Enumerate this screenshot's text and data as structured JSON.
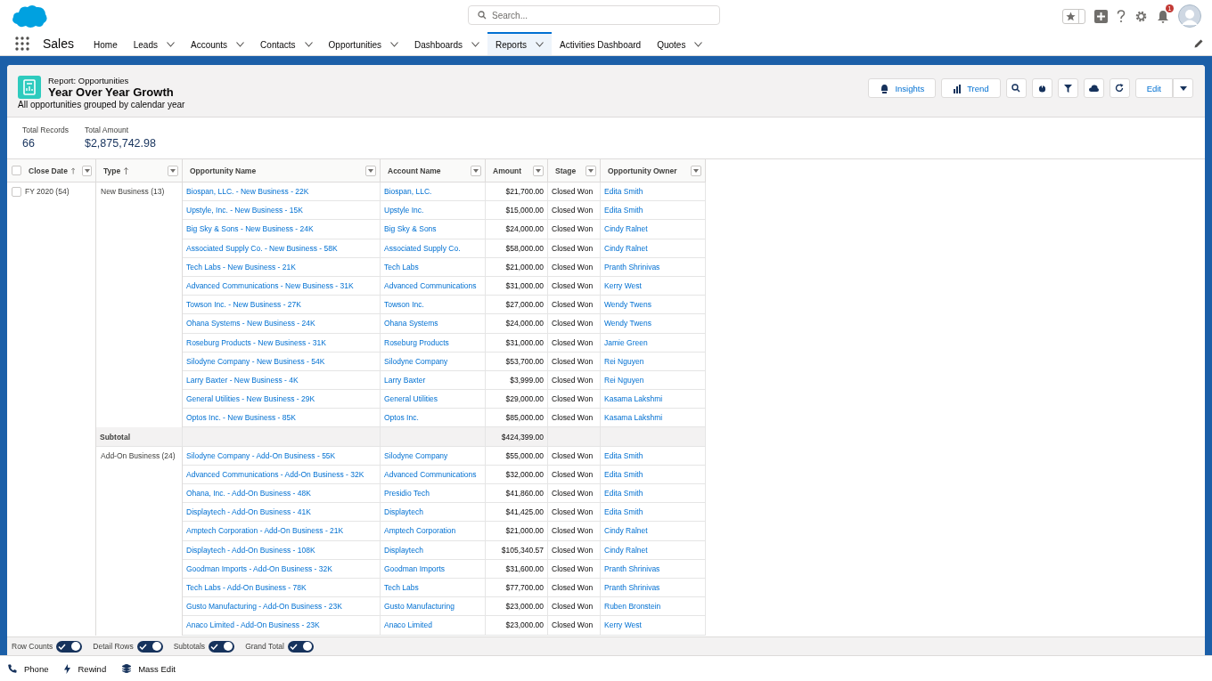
{
  "header": {
    "search": {
      "placeholder": "Search..."
    },
    "notification_count": "1"
  },
  "app_name": "Sales",
  "nav": [
    {
      "label": "Home",
      "selected": false,
      "has_menu": false
    },
    {
      "label": "Leads",
      "selected": false,
      "has_menu": true
    },
    {
      "label": "Accounts",
      "selected": false,
      "has_menu": true
    },
    {
      "label": "Contacts",
      "selected": false,
      "has_menu": true
    },
    {
      "label": "Opportunities",
      "selected": false,
      "has_menu": true
    },
    {
      "label": "Dashboards",
      "selected": false,
      "has_menu": true
    },
    {
      "label": "Reports",
      "selected": true,
      "has_menu": true
    },
    {
      "label": "Activities Dashboard",
      "selected": false,
      "has_menu": false
    },
    {
      "label": "Quotes",
      "selected": false,
      "has_menu": true
    }
  ],
  "report": {
    "type_label": "Report: Opportunities",
    "title": "Year Over Year Growth",
    "description": "All opportunities grouped by calendar year",
    "actions": [
      {
        "kind": "insights",
        "label": "Insights"
      },
      {
        "kind": "trend",
        "label": "Trend"
      },
      {
        "kind": "search"
      },
      {
        "kind": "chart"
      },
      {
        "kind": "filter"
      },
      {
        "kind": "cloud"
      },
      {
        "kind": "refresh"
      },
      {
        "kind": "edit",
        "label": "Edit"
      },
      {
        "kind": "more"
      }
    ],
    "summary": [
      {
        "label": "Total Records",
        "value": "66"
      },
      {
        "label": "Total Amount",
        "value": "$2,875,742.98"
      }
    ]
  },
  "table": {
    "columns": [
      {
        "label": "Close Date",
        "sorted": true
      },
      {
        "label": "Type",
        "sorted": true
      },
      {
        "label": "Opportunity Name",
        "sorted": false
      },
      {
        "label": "Account Name",
        "sorted": false
      },
      {
        "label": "Amount",
        "sorted": false
      },
      {
        "label": "Stage",
        "sorted": false
      },
      {
        "label": "Opportunity Owner",
        "sorted": false
      }
    ],
    "close_date_group": {
      "label": "FY 2020 (54)",
      "checked": false
    },
    "groups": [
      {
        "type": "New Business (13)",
        "rows": [
          [
            "Biospan, LLC. - New Business - 22K",
            "Biospan, LLC.",
            "$21,700.00",
            "Closed Won",
            "Edita Smith"
          ],
          [
            "Upstyle, Inc. - New Business - 15K",
            "Upstyle Inc.",
            "$15,000.00",
            "Closed Won",
            "Edita Smith"
          ],
          [
            "Big Sky & Sons - New Business - 24K",
            "Big Sky & Sons",
            "$24,000.00",
            "Closed Won",
            "Cindy Ralnet"
          ],
          [
            "Associated Supply Co. - New Business - 58K",
            "Associated Supply Co.",
            "$58,000.00",
            "Closed Won",
            "Cindy Ralnet"
          ],
          [
            "Tech Labs - New Business - 21K",
            "Tech Labs",
            "$21,000.00",
            "Closed Won",
            "Pranth Shrinivas"
          ],
          [
            "Advanced Communications - New Business - 31K",
            "Advanced Communications",
            "$31,000.00",
            "Closed Won",
            "Kerry West"
          ],
          [
            "Towson Inc. - New Business - 27K",
            "Towson Inc.",
            "$27,000.00",
            "Closed Won",
            "Wendy Twens"
          ],
          [
            "Ohana Systems - New Business - 24K",
            "Ohana Systems",
            "$24,000.00",
            "Closed Won",
            "Wendy Twens"
          ],
          [
            "Roseburg Products - New Business - 31K",
            "Roseburg Products",
            "$31,000.00",
            "Closed Won",
            "Jamie Green"
          ],
          [
            "Silodyne Company - New Business - 54K",
            "Silodyne Company",
            "$53,700.00",
            "Closed Won",
            "Rei Nguyen"
          ],
          [
            "Larry Baxter - New Business - 4K",
            "Larry Baxter",
            "$3,999.00",
            "Closed Won",
            "Rei Nguyen"
          ],
          [
            "General Utilities - New Business - 29K",
            "General Utilities",
            "$29,000.00",
            "Closed Won",
            "Kasama Lakshmi"
          ],
          [
            "Optos Inc. - New Business - 85K",
            "Optos Inc.",
            "$85,000.00",
            "Closed Won",
            "Kasama Lakshmi"
          ]
        ],
        "subtotal": {
          "label": "Subtotal",
          "amount": "$424,399.00"
        }
      },
      {
        "type": "Add-On Business (24)",
        "rows": [
          [
            "Silodyne Company - Add-On Business - 55K",
            "Silodyne Company",
            "$55,000.00",
            "Closed Won",
            "Edita Smith"
          ],
          [
            "Advanced Communications - Add-On Business - 32K",
            "Advanced Communications",
            "$32,000.00",
            "Closed Won",
            "Edita Smith"
          ],
          [
            "Ohana, Inc. - Add-On Business - 48K",
            "Presidio Tech",
            "$41,860.00",
            "Closed Won",
            "Edita Smith"
          ],
          [
            "Displaytech - Add-On Business - 41K",
            "Displaytech",
            "$41,425.00",
            "Closed Won",
            "Edita Smith"
          ],
          [
            "Amptech Corporation - Add-On Business - 21K",
            "Amptech Corporation",
            "$21,000.00",
            "Closed Won",
            "Cindy Ralnet"
          ],
          [
            "Displaytech - Add-On Business - 108K",
            "Displaytech",
            "$105,340.57",
            "Closed Won",
            "Cindy Ralnet"
          ],
          [
            "Goodman Imports - Add-On Business - 32K",
            "Goodman Imports",
            "$31,600.00",
            "Closed Won",
            "Pranth Shrinivas"
          ],
          [
            "Tech Labs - Add-On Business - 78K",
            "Tech Labs",
            "$77,700.00",
            "Closed Won",
            "Pranth Shrinivas"
          ],
          [
            "Gusto Manufacturing - Add-On Business - 23K",
            "Gusto Manufacturing",
            "$23,000.00",
            "Closed Won",
            "Ruben Bronstein"
          ],
          [
            "Anaco Limited - Add-On Business - 23K",
            "Anaco Limited",
            "$23,000.00",
            "Closed Won",
            "Kerry West"
          ]
        ]
      }
    ]
  },
  "toggles": [
    {
      "label": "Row Counts",
      "on": true
    },
    {
      "label": "Detail Rows",
      "on": true
    },
    {
      "label": "Subtotals",
      "on": true
    },
    {
      "label": "Grand Total",
      "on": true
    }
  ],
  "utility_bar": [
    {
      "kind": "phone",
      "label": "Phone"
    },
    {
      "kind": "rewind",
      "label": "Rewind"
    },
    {
      "kind": "mass_edit",
      "label": "Mass Edit"
    }
  ]
}
